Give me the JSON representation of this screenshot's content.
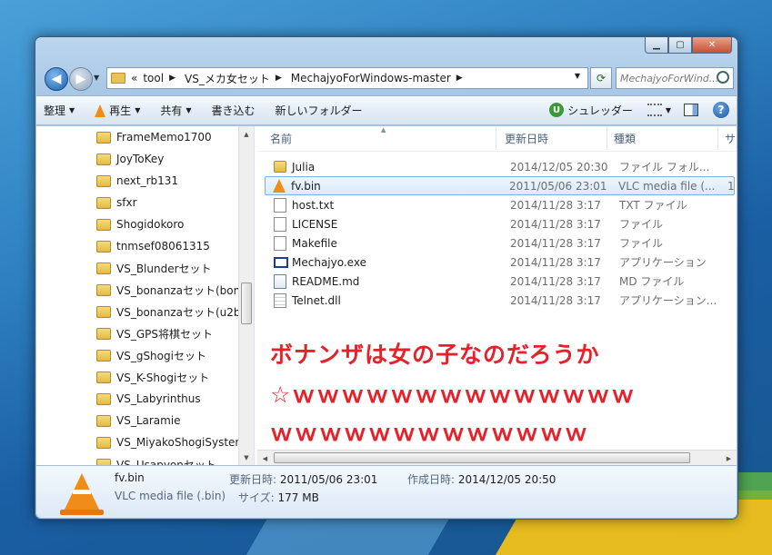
{
  "address": {
    "chevron": "«",
    "crumbs": [
      "tool",
      "VS_メカ女セット",
      "MechajyoForWindows-master"
    ]
  },
  "search": {
    "placeholder": "MechajyoForWind..."
  },
  "toolbar": {
    "organize": "整理",
    "play": "再生",
    "share": "共有",
    "burn": "書き込む",
    "new_folder": "新しいフォルダー",
    "shredder": "シュレッダー"
  },
  "tree": {
    "items": [
      "FrameMemo1700",
      "JoyToKey",
      "next_rb131",
      "sfxr",
      "Shogidokoro",
      "tnmsef08061315",
      "VS_Blunderセット",
      "VS_bonanzaセット(bon",
      "VS_bonanzaセット(u2b",
      "VS_GPS将棋セット",
      "VS_gShogiセット",
      "VS_K-Shogiセット",
      "VS_Labyrinthus",
      "VS_Laramie",
      "VS_MiyakoShogiSyster",
      "VS_Usapyonセット"
    ]
  },
  "columns": {
    "name": "名前",
    "date": "更新日時",
    "type": "種類",
    "size": "サ"
  },
  "files": [
    {
      "name": "Julia",
      "date": "2014/12/05 20:30",
      "type": "ファイル フォル...",
      "size": "",
      "icon": "folder-icon"
    },
    {
      "name": "fv.bin",
      "date": "2011/05/06 23:01",
      "type": "VLC media file (...",
      "size": "1",
      "icon": "vlc-icon"
    },
    {
      "name": "host.txt",
      "date": "2014/11/28 3:17",
      "type": "TXT ファイル",
      "size": "",
      "icon": "text-file-icon"
    },
    {
      "name": "LICENSE",
      "date": "2014/11/28 3:17",
      "type": "ファイル",
      "size": "",
      "icon": "file-icon"
    },
    {
      "name": "Makefile",
      "date": "2014/11/28 3:17",
      "type": "ファイル",
      "size": "",
      "icon": "file-icon"
    },
    {
      "name": "Mechajyo.exe",
      "date": "2014/11/28 3:17",
      "type": "アプリケーション",
      "size": "",
      "icon": "exe-icon"
    },
    {
      "name": "README.md",
      "date": "2014/11/28 3:17",
      "type": "MD ファイル",
      "size": "",
      "icon": "md-file-icon"
    },
    {
      "name": "Telnet.dll",
      "date": "2014/11/28 3:17",
      "type": "アプリケーション...",
      "size": "",
      "icon": "dll-icon"
    }
  ],
  "overlay": {
    "line1": "ボナンザは女の子なのだろうか",
    "line2": "☆ｗｗｗｗｗｗｗｗｗｗｗｗｗｗ",
    "line3": "ｗｗｗｗｗｗｗｗｗｗｗｗｗ"
  },
  "details": {
    "name": "fv.bin",
    "type": "VLC media file (.bin)",
    "modified_label": "更新日時:",
    "modified": "2011/05/06 23:01",
    "created_label": "作成日時:",
    "created": "2014/12/05 20:50",
    "size_label": "サイズ:",
    "size": "177 MB"
  },
  "colors": {
    "overlay_text": "#e8202a",
    "vlc_orange": "#f08c1a"
  }
}
